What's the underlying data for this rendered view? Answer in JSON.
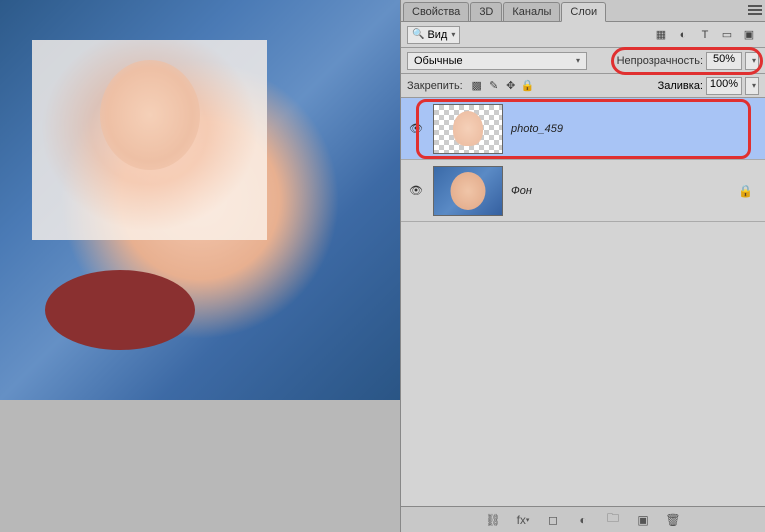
{
  "tabs": {
    "properties": "Свойства",
    "threed": "3D",
    "channels": "Каналы",
    "layers": "Слои"
  },
  "filter": {
    "kind": "Вид"
  },
  "blend": {
    "mode": "Обычные",
    "opacity_label": "Непрозрачность:",
    "opacity_value": "50%"
  },
  "lock": {
    "label": "Закрепить:",
    "fill_label": "Заливка:",
    "fill_value": "100%"
  },
  "layers": [
    {
      "name": "photo_459",
      "selected": true,
      "locked": false
    },
    {
      "name": "Фон",
      "selected": false,
      "locked": true
    }
  ]
}
